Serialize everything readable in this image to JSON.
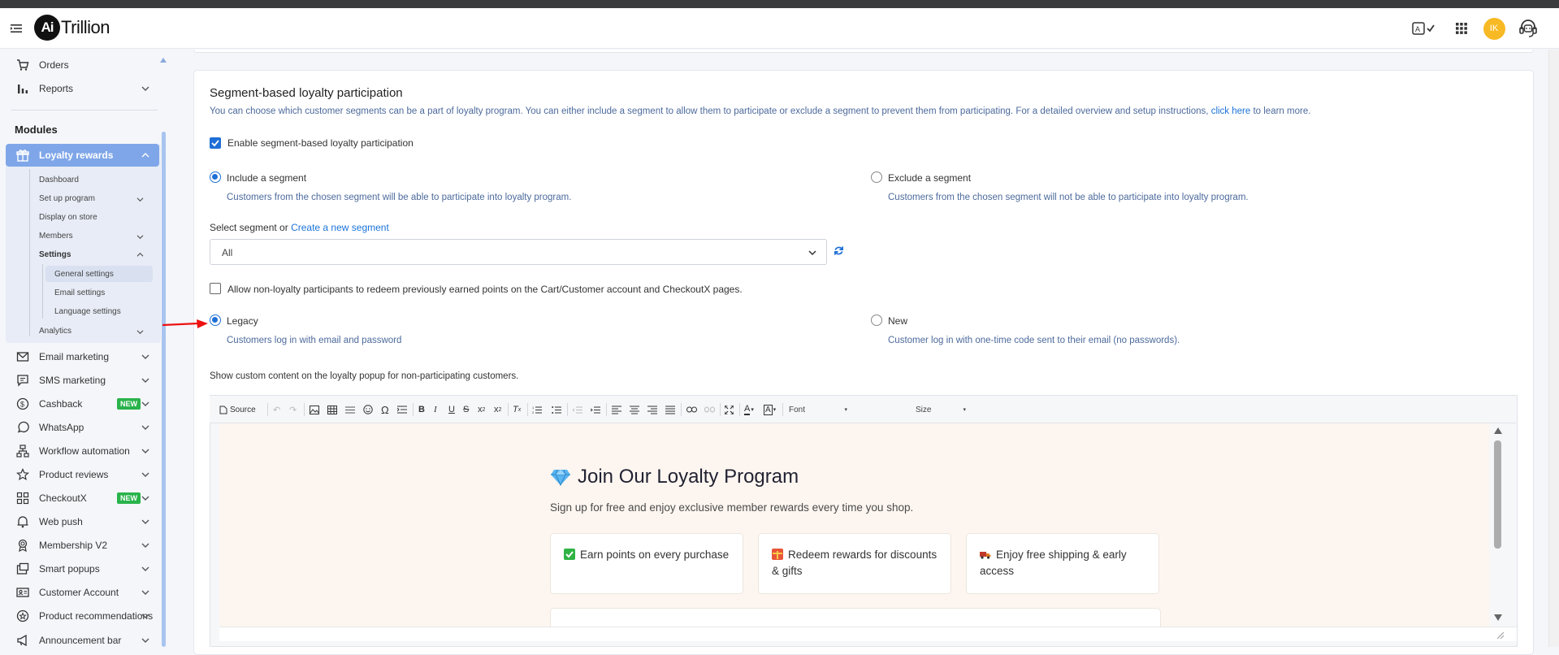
{
  "header": {
    "logo_badge": "Ai",
    "logo_text": "Trillion",
    "avatar_initials": "IK"
  },
  "sidebar": {
    "top_items": [
      {
        "label": "Orders",
        "icon": "cart-icon"
      },
      {
        "label": "Reports",
        "icon": "bar-chart-icon"
      }
    ],
    "modules_heading": "Modules",
    "loyalty": {
      "label": "Loyalty rewards",
      "sub_items": [
        "Dashboard",
        "Set up program",
        "Display on store",
        "Members",
        "Settings",
        "Analytics"
      ],
      "settings_sub": [
        "General settings",
        "Email settings",
        "Language settings"
      ]
    },
    "items": [
      {
        "label": "Email marketing",
        "icon": "mail-icon"
      },
      {
        "label": "SMS marketing",
        "icon": "chat-icon"
      },
      {
        "label": "Cashback",
        "icon": "dollar-icon",
        "badge": "NEW"
      },
      {
        "label": "WhatsApp",
        "icon": "whatsapp-icon"
      },
      {
        "label": "Workflow automation",
        "icon": "workflow-icon"
      },
      {
        "label": "Product reviews",
        "icon": "star-icon"
      },
      {
        "label": "CheckoutX",
        "icon": "grid-icon",
        "badge": "NEW"
      },
      {
        "label": "Web push",
        "icon": "bell-icon"
      },
      {
        "label": "Membership V2",
        "icon": "badge-icon"
      },
      {
        "label": "Smart popups",
        "icon": "popup-icon"
      },
      {
        "label": "Customer Account",
        "icon": "id-card-icon"
      },
      {
        "label": "Product recommendations",
        "icon": "recommend-icon"
      },
      {
        "label": "Announcement bar",
        "icon": "megaphone-icon"
      }
    ]
  },
  "section": {
    "title": "Segment-based loyalty participation",
    "description": "You can choose which customer segments can be a part of loyalty program. You can either include a segment to allow them to participate or exclude a segment to prevent them from participating. For a detailed overview and setup instructions,",
    "link": "click here",
    "description_end": "to learn more.",
    "enable_label": "Enable segment-based loyalty participation",
    "include_label": "Include a segment",
    "include_hint": "Customers from the chosen segment will be able to participate into loyalty program.",
    "exclude_label": "Exclude a segment",
    "exclude_hint": "Customers from the chosen segment will not be able to participate into loyalty program.",
    "select_label": "Select segment or",
    "create_link": "Create a new segment",
    "select_value": "All",
    "allow_label": "Allow non-loyalty participants to redeem previously earned points on the Cart/Customer account and CheckoutX pages.",
    "legacy_label": "Legacy",
    "legacy_hint": "Customers log in with email and password",
    "new_label": "New",
    "new_hint": "Customer log in with one-time code sent to their email (no passwords).",
    "custom_content_label": "Show custom content on the loyalty popup for non-participating customers."
  },
  "editor": {
    "source_label": "Source",
    "font_label": "Font",
    "size_label": "Size",
    "content": {
      "title": "Join Our Loyalty Program",
      "subtitle": "Sign up for free and enjoy exclusive member rewards every time you shop.",
      "benefits": [
        {
          "text": "Earn points on every purchase",
          "color": "#2fb344"
        },
        {
          "text": "Redeem rewards for discounts & gifts",
          "color": "#e8553a"
        },
        {
          "text": "Enjoy free shipping & early access",
          "color": "#c0392b"
        }
      ]
    }
  },
  "colors": {
    "accent": "#1f6fd6",
    "sidebar_active": "#7fa6e8",
    "badge_new": "#29b34b"
  }
}
